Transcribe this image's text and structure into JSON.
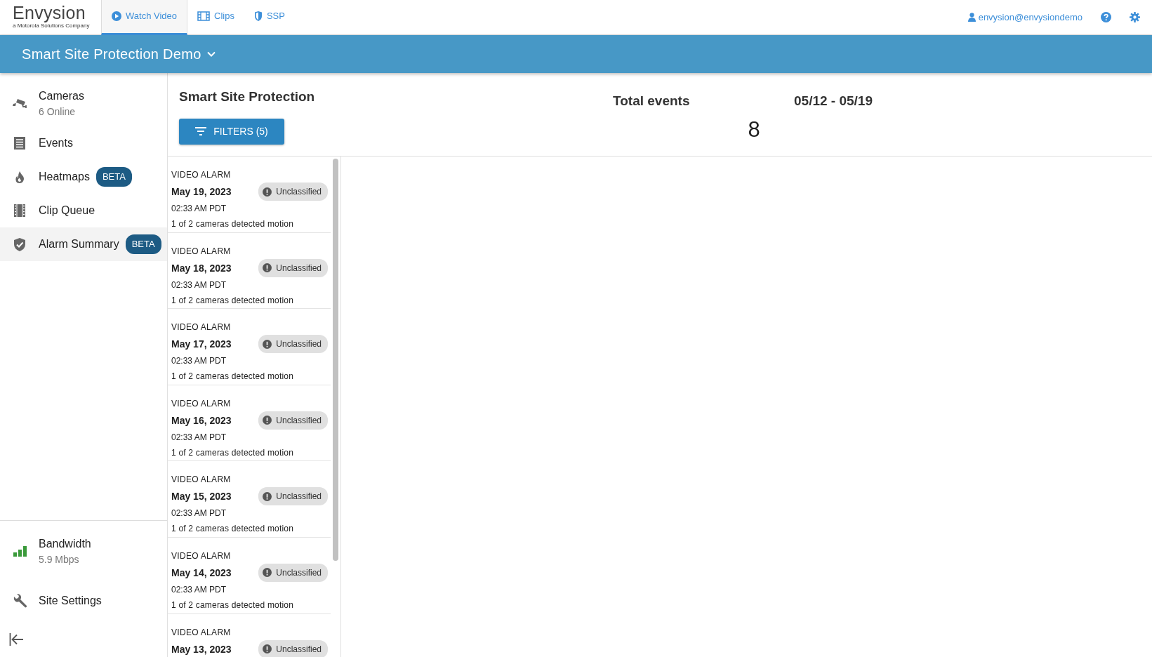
{
  "logo": {
    "brand": "Envysion",
    "tagline": "a Motorola Solutions Company"
  },
  "tabs": [
    {
      "kind": "video",
      "label": "Watch Video",
      "selected": true
    },
    {
      "kind": "clips",
      "label": "Clips",
      "selected": false
    },
    {
      "kind": "shield",
      "label": "SSP",
      "selected": false
    }
  ],
  "user": "envysion@envysiondemo",
  "site_title": "Smart Site Protection Demo",
  "sidebar": {
    "items": [
      {
        "kind": "camera",
        "label": "Cameras",
        "subtitle": "6 Online",
        "selected": false
      },
      {
        "kind": "events",
        "label": "Events",
        "selected": false
      },
      {
        "kind": "heatmap",
        "label": "Heatmaps",
        "badge": "BETA",
        "selected": false
      },
      {
        "kind": "clips",
        "label": "Clip Queue",
        "selected": false
      },
      {
        "kind": "alarm",
        "label": "Alarm Summary",
        "badge": "BETA",
        "selected": true
      }
    ],
    "bottom_items": [
      {
        "kind": "bandwidth",
        "label": "Bandwidth",
        "subtitle": "5.9 Mbps"
      },
      {
        "kind": "wrench",
        "label": "Site Settings"
      }
    ]
  },
  "header": {
    "title": "Smart Site Protection",
    "filters_button": "FILTERS (5)",
    "total_label": "Total events",
    "total_value": "8",
    "date_range": "05/12 - 05/19"
  },
  "events": [
    {
      "type": "VIDEO ALARM",
      "date": "May 19, 2023",
      "time": "02:33 AM PDT",
      "description": "1 of 2 cameras detected motion",
      "status": "Unclassified"
    },
    {
      "type": "VIDEO ALARM",
      "date": "May 18, 2023",
      "time": "02:33 AM PDT",
      "description": "1 of 2 cameras detected motion",
      "status": "Unclassified"
    },
    {
      "type": "VIDEO ALARM",
      "date": "May 17, 2023",
      "time": "02:33 AM PDT",
      "description": "1 of 2 cameras detected motion",
      "status": "Unclassified"
    },
    {
      "type": "VIDEO ALARM",
      "date": "May 16, 2023",
      "time": "02:33 AM PDT",
      "description": "1 of 2 cameras detected motion",
      "status": "Unclassified"
    },
    {
      "type": "VIDEO ALARM",
      "date": "May 15, 2023",
      "time": "02:33 AM PDT",
      "description": "1 of 2 cameras detected motion",
      "status": "Unclassified"
    },
    {
      "type": "VIDEO ALARM",
      "date": "May 14, 2023",
      "time": "02:33 AM PDT",
      "description": "1 of 2 cameras detected motion",
      "status": "Unclassified"
    },
    {
      "type": "VIDEO ALARM",
      "date": "May 13, 2023",
      "status": "Unclassified"
    }
  ]
}
